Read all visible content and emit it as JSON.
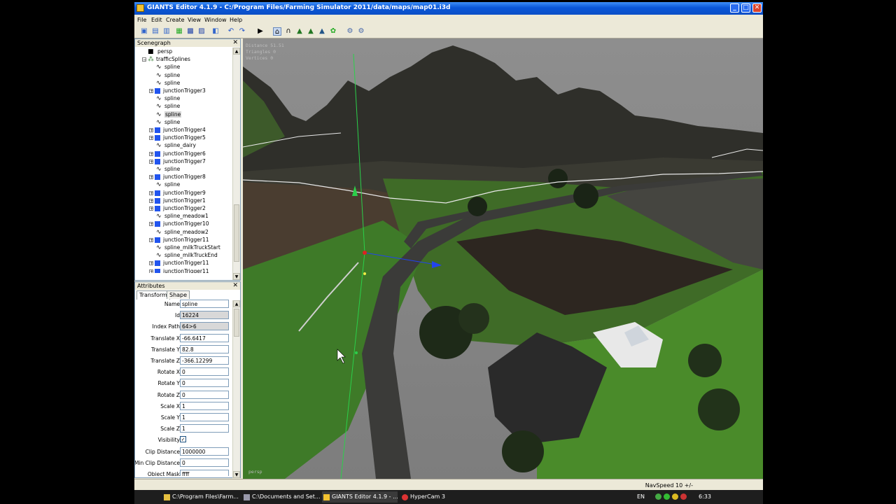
{
  "window": {
    "title": "GIANTS Editor 4.1.9 - C:/Program Files/Farming Simulator 2011/data/maps/map01.i3d"
  },
  "menu": [
    "File",
    "Edit",
    "Create",
    "View",
    "Window",
    "Help"
  ],
  "scenegraph": {
    "title": "Scenegraph",
    "items": [
      {
        "label": "persp",
        "type": "camera",
        "indent": 0
      },
      {
        "label": "trafficSplines",
        "type": "group",
        "indent": 0,
        "expanded": true
      },
      {
        "label": "spline",
        "type": "spline",
        "indent": 1
      },
      {
        "label": "spline",
        "type": "spline",
        "indent": 1
      },
      {
        "label": "spline",
        "type": "spline",
        "indent": 1
      },
      {
        "label": "junctionTrigger3",
        "type": "trigger",
        "indent": 1
      },
      {
        "label": "spline",
        "type": "spline",
        "indent": 1
      },
      {
        "label": "spline",
        "type": "spline",
        "indent": 1
      },
      {
        "label": "spline",
        "type": "spline",
        "indent": 1,
        "selected": true
      },
      {
        "label": "spline",
        "type": "spline",
        "indent": 1
      },
      {
        "label": "junctionTrigger4",
        "type": "trigger",
        "indent": 1
      },
      {
        "label": "junctionTrigger5",
        "type": "trigger",
        "indent": 1
      },
      {
        "label": "spline_dairy",
        "type": "spline",
        "indent": 1
      },
      {
        "label": "junctionTrigger6",
        "type": "trigger",
        "indent": 1
      },
      {
        "label": "junctionTrigger7",
        "type": "trigger",
        "indent": 1
      },
      {
        "label": "spline",
        "type": "spline",
        "indent": 1
      },
      {
        "label": "junctionTrigger8",
        "type": "trigger",
        "indent": 1
      },
      {
        "label": "spline",
        "type": "spline",
        "indent": 1
      },
      {
        "label": "junctionTrigger9",
        "type": "trigger",
        "indent": 1
      },
      {
        "label": "junctionTrigger1",
        "type": "trigger",
        "indent": 1
      },
      {
        "label": "junctionTrigger2",
        "type": "trigger",
        "indent": 1
      },
      {
        "label": "spline_meadow1",
        "type": "spline",
        "indent": 1
      },
      {
        "label": "junctionTrigger10",
        "type": "trigger",
        "indent": 1
      },
      {
        "label": "spline_meadow2",
        "type": "spline",
        "indent": 1
      },
      {
        "label": "junctionTrigger11",
        "type": "trigger",
        "indent": 1
      },
      {
        "label": "spline_milkTruckStart",
        "type": "spline",
        "indent": 1
      },
      {
        "label": "spline_milkTruckEnd",
        "type": "spline",
        "indent": 1
      },
      {
        "label": "junctionTrigger11",
        "type": "trigger",
        "indent": 1
      },
      {
        "label": "junctionTrigger11",
        "type": "trigger",
        "indent": 1
      }
    ]
  },
  "attributes": {
    "title": "Attributes",
    "tabs": [
      "Transform",
      "Shape"
    ],
    "fields": [
      {
        "label": "Name",
        "value": "spline",
        "readonly": false
      },
      {
        "label": "Id",
        "value": "16224",
        "readonly": true
      },
      {
        "label": "Index Path",
        "value": "64>6",
        "readonly": true
      },
      {
        "label": "Translate X",
        "value": "-66.6417",
        "readonly": false
      },
      {
        "label": "Translate Y",
        "value": "82.8",
        "readonly": false
      },
      {
        "label": "Translate Z",
        "value": "-366.12299",
        "readonly": false
      },
      {
        "label": "Rotate X",
        "value": "0",
        "readonly": false
      },
      {
        "label": "Rotate Y",
        "value": "0",
        "readonly": false
      },
      {
        "label": "Rotate Z",
        "value": "0",
        "readonly": false
      },
      {
        "label": "Scale X",
        "value": "1",
        "readonly": false
      },
      {
        "label": "Scale Y",
        "value": "1",
        "readonly": false
      },
      {
        "label": "Scale Z",
        "value": "1",
        "readonly": false
      },
      {
        "label": "Visibility",
        "value": "✓",
        "checkbox": true
      },
      {
        "label": "Clip Distance",
        "value": "1000000",
        "readonly": false
      },
      {
        "label": "Min Clip Distance",
        "value": "0",
        "readonly": false
      },
      {
        "label": "Object Mask",
        "value": "ffff",
        "readonly": false
      }
    ]
  },
  "viewport": {
    "stats": [
      "Distance 51.51",
      "Triangles 0",
      "Vertices 0"
    ],
    "camera_label": "persp"
  },
  "status": {
    "navspeed": "NavSpeed 10 +/-"
  },
  "taskbar": {
    "items": [
      "C:\\Program Files\\Farm...",
      "C:\\Documents and Set...",
      "GIANTS Editor 4.1.9 - ...",
      "HyperCam 3"
    ],
    "lang": "EN",
    "clock": "6:33"
  },
  "colors": {
    "titlebar": "#0a56d8",
    "selection": "#d6d6d6",
    "trigger_icon": "#2255ee",
    "gizmo_y": "#22cc44",
    "gizmo_x": "#2244ee",
    "gizmo_center": "#dd2222"
  }
}
